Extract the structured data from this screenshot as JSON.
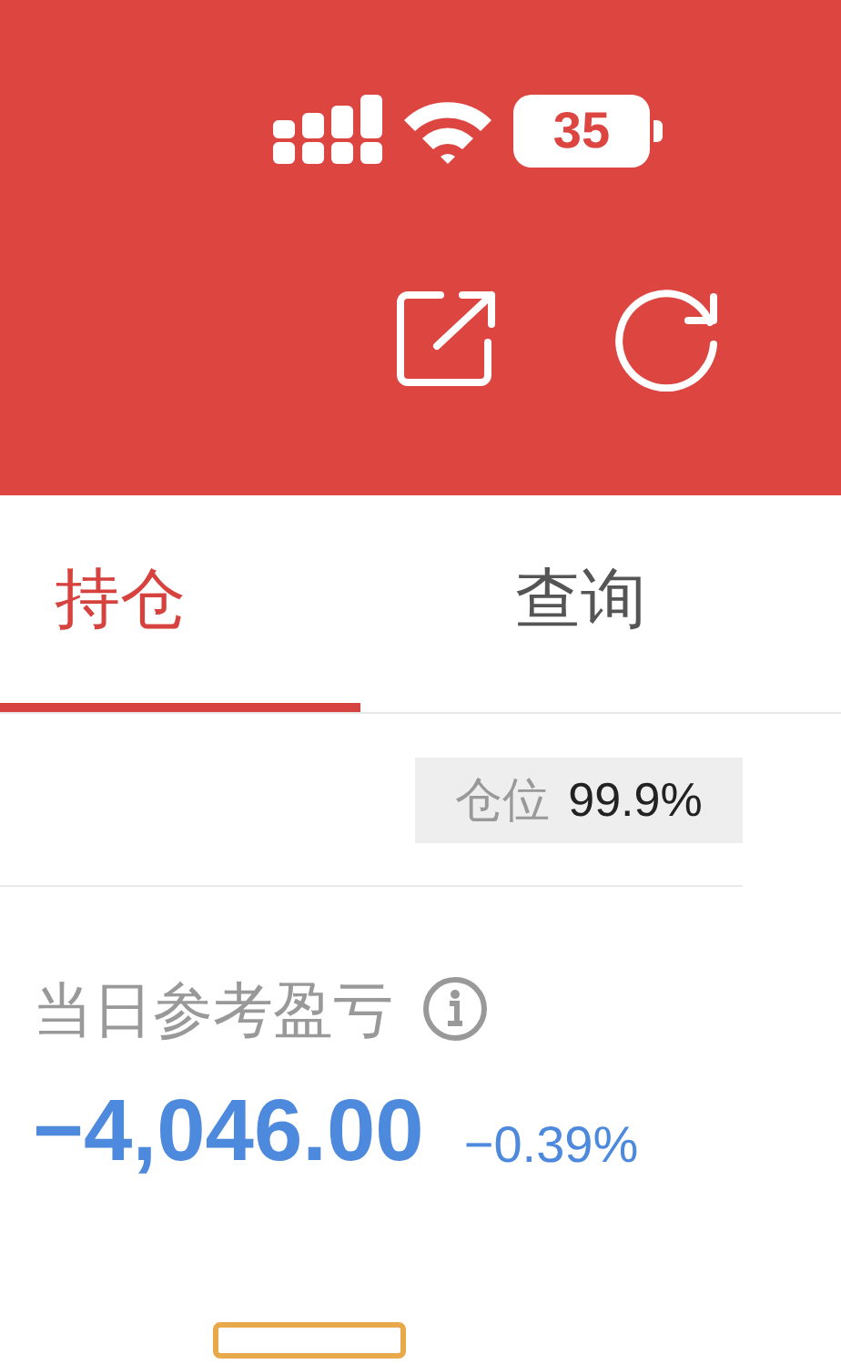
{
  "status_bar": {
    "battery": "35"
  },
  "tabs": [
    {
      "label": "持仓",
      "selected": true
    },
    {
      "label": "查询",
      "selected": false
    }
  ],
  "position": {
    "label": "仓位",
    "value": "99.9%"
  },
  "daily_pnl": {
    "label": "当日参考盈亏",
    "amount": "−4,046.00",
    "percent": "−0.39%"
  }
}
